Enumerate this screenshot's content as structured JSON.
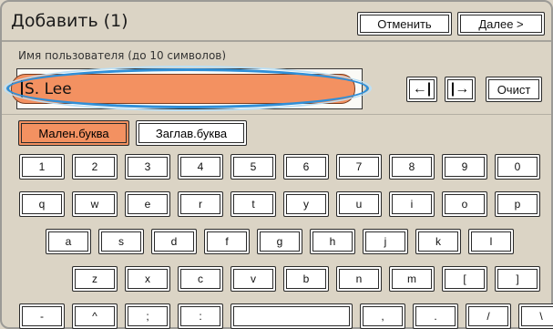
{
  "dialog": {
    "title": "Добавить (1)",
    "cancel_label": "Отменить",
    "next_label": "Далее >"
  },
  "input": {
    "label": "Имя пользователя (до 10 символов)",
    "value": "S. Lee",
    "max_length": 10
  },
  "controls": {
    "cursor_left_label": "←|",
    "cursor_right_label": "|→",
    "clear_label": "Очист"
  },
  "case_mode": {
    "lower_label": "Мален.буква",
    "upper_label": "Заглав.буква",
    "selected": "lower"
  },
  "keyboard": {
    "row1": [
      "1",
      "2",
      "3",
      "4",
      "5",
      "6",
      "7",
      "8",
      "9",
      "0"
    ],
    "row2": [
      "q",
      "w",
      "e",
      "r",
      "t",
      "y",
      "u",
      "i",
      "o",
      "p"
    ],
    "row3": [
      "a",
      "s",
      "d",
      "f",
      "g",
      "h",
      "j",
      "k",
      "l"
    ],
    "row4": [
      "z",
      "x",
      "c",
      "v",
      "b",
      "n",
      "m",
      "[",
      "]"
    ],
    "row5": [
      "-",
      "^",
      ";",
      ":",
      "",
      ",",
      ".",
      "/",
      "\\"
    ]
  },
  "colors": {
    "background": "#dbd4c5",
    "accent": "#f39161",
    "focus_ring": "#2f8fd8"
  }
}
